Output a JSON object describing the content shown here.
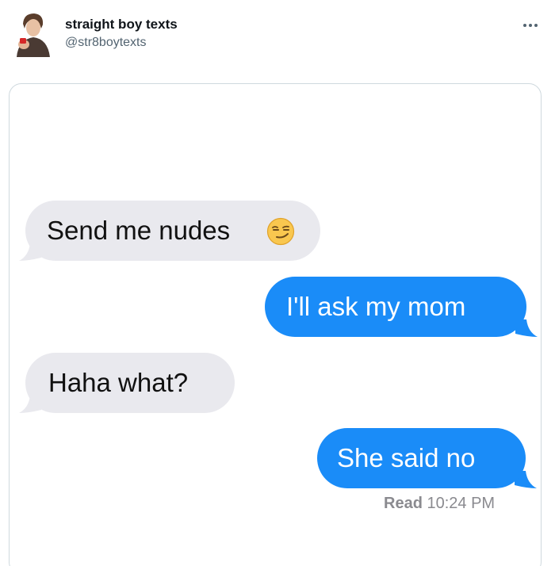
{
  "tweet": {
    "display_name": "straight boy texts",
    "handle": "@str8boytexts"
  },
  "messages": [
    {
      "text": "Send me nudes",
      "direction": "incoming",
      "emoji": "smirk-emoji"
    },
    {
      "text": "I'll ask my mom",
      "direction": "outgoing"
    },
    {
      "text": "Haha what?",
      "direction": "incoming"
    },
    {
      "text": "She said no",
      "direction": "outgoing"
    }
  ],
  "receipt": {
    "label": "Read",
    "time": "10:24 PM"
  },
  "colors": {
    "incoming_bubble": "#e9e9ee",
    "outgoing_bubble": "#1a8cf8",
    "name_text": "#0f1419",
    "handle_text": "#536471"
  },
  "icons": {
    "more": "more-options-icon",
    "avatar": "avatar"
  }
}
